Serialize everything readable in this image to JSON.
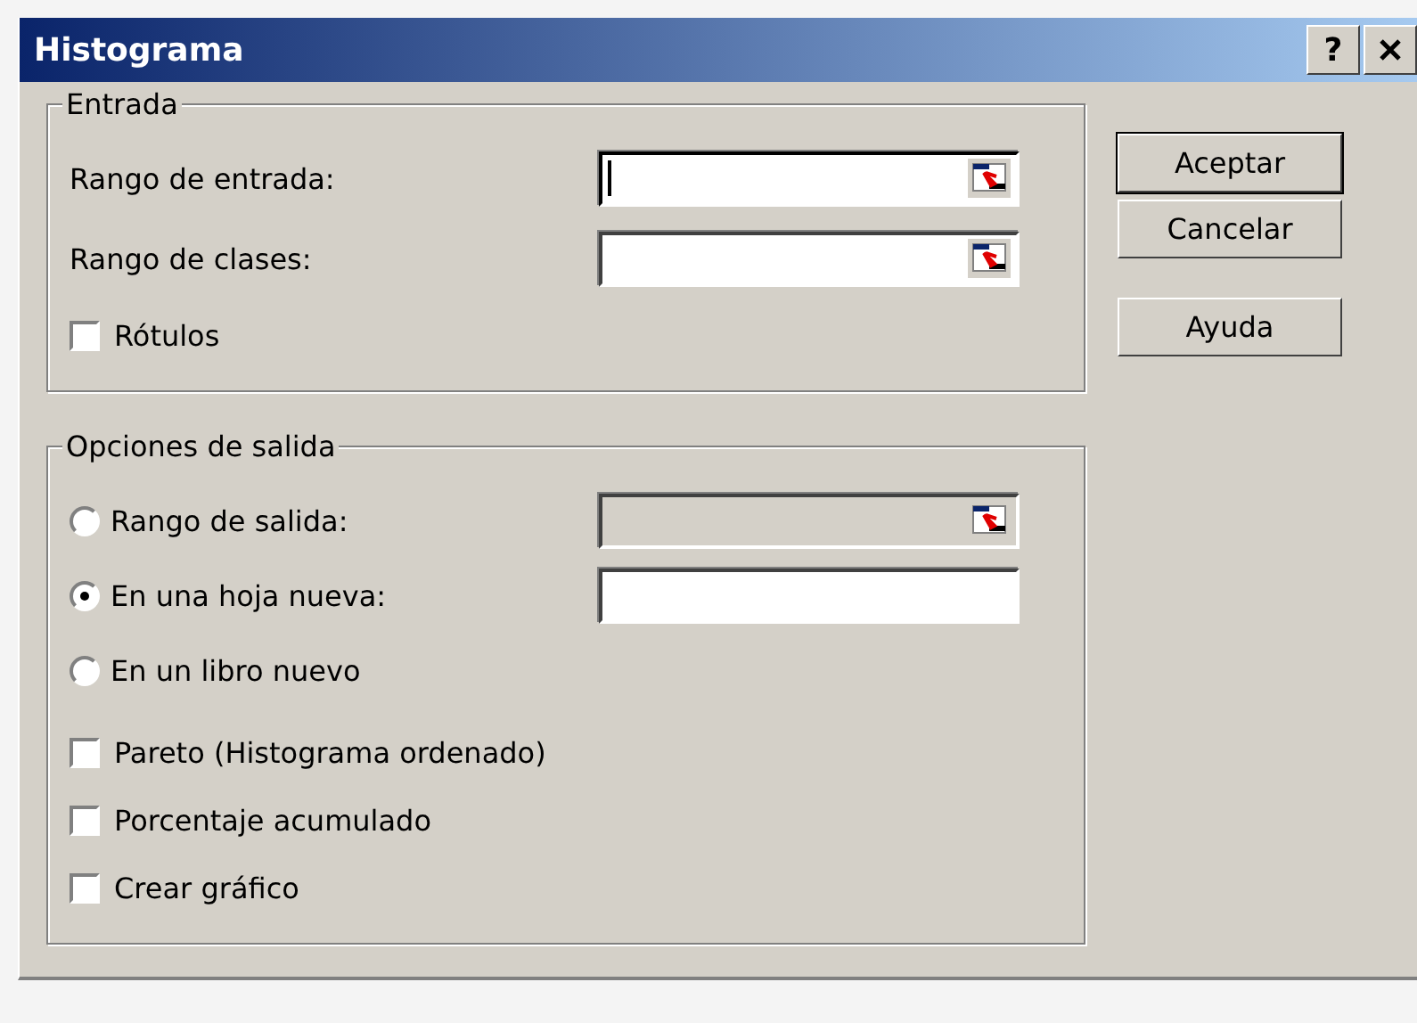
{
  "window": {
    "title": "Histograma",
    "help_button": "?"
  },
  "input_group": {
    "title": "Entrada",
    "fields": [
      {
        "label": "Rango de entrada:",
        "focused": true
      },
      {
        "label": "Rango de clases:",
        "focused": false
      }
    ],
    "checkboxes": [
      {
        "label": "Rótulos",
        "checked": false
      }
    ]
  },
  "output_group": {
    "title": "Opciones de salida",
    "options": [
      {
        "label": "Rango de salida:",
        "selected": false,
        "field": {
          "kind": "range",
          "disabled": true
        }
      },
      {
        "label": "En una hoja nueva:",
        "selected": true,
        "field": {
          "kind": "text",
          "disabled": false
        }
      },
      {
        "label": "En un libro nuevo",
        "selected": false
      }
    ],
    "checkboxes": [
      {
        "label": "Pareto (Histograma ordenado)",
        "checked": false
      },
      {
        "label": "Porcentaje acumulado",
        "checked": false
      },
      {
        "label": "Crear gráfico",
        "checked": false
      }
    ]
  },
  "buttons": [
    {
      "label": "Aceptar",
      "default": true
    },
    {
      "label": "Cancelar",
      "default": false
    },
    {
      "label": "Ayuda",
      "default": false
    }
  ]
}
